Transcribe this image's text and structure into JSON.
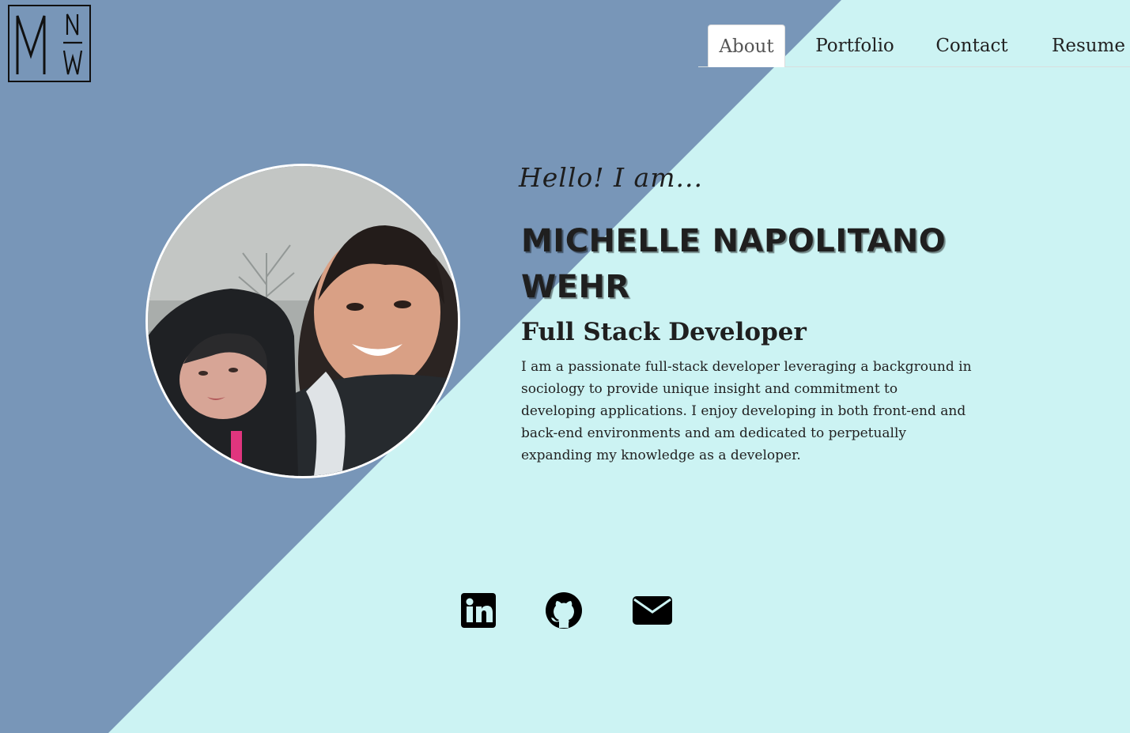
{
  "logo": {
    "letters_main": "M",
    "letters_top": "N",
    "letters_bottom": "W"
  },
  "nav": {
    "tabs": [
      {
        "label": "About",
        "active": true
      },
      {
        "label": "Portfolio",
        "active": false
      },
      {
        "label": "Contact",
        "active": false
      },
      {
        "label": "Resume",
        "active": false
      }
    ]
  },
  "hero": {
    "greeting": "Hello! I am...",
    "name": "MICHELLE NAPOLITANO WEHR",
    "title": "Full Stack Developer",
    "bio": "I am a passionate full-stack developer leveraging a background in sociology to provide unique insight and commitment to developing applications. I enjoy developing in both front-end and back-end environments and am dedicated to perpetually expanding my knowledge as a developer."
  },
  "social": [
    {
      "icon": "linkedin-icon"
    },
    {
      "icon": "github-icon"
    },
    {
      "icon": "envelope-icon"
    }
  ],
  "colors": {
    "background_light": "#ccf3f3",
    "background_dark": "#7896b8",
    "text": "#1f1f1f"
  }
}
